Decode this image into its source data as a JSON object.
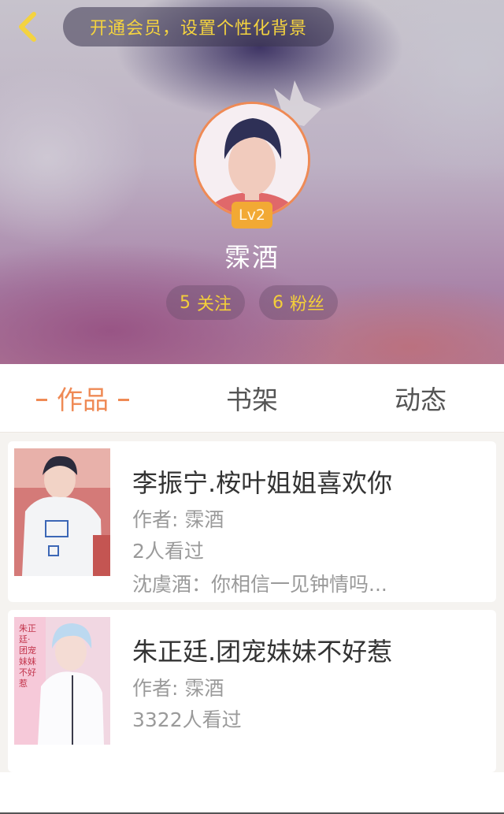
{
  "header": {
    "back_icon": "chevron-left-icon",
    "vip_banner": "开通会员，设置个性化背景",
    "level": "Lv2",
    "username": "霂酒",
    "following": {
      "count": "5",
      "label": "关注"
    },
    "followers": {
      "count": "6",
      "label": "粉丝"
    }
  },
  "tabs": [
    {
      "label": "作品",
      "active": true
    },
    {
      "label": "书架",
      "active": false
    },
    {
      "label": "动态",
      "active": false
    }
  ],
  "works": [
    {
      "title": "李振宁.桉叶姐姐喜欢你",
      "author": "作者: 霂酒",
      "views": "2人看过",
      "excerpt": "沈虞酒：你相信一见钟情吗..."
    },
    {
      "title": "朱正廷.团宠妹妹不好惹",
      "author": "作者: 霂酒",
      "views": "3322人看过",
      "cover_text": "朱正廷·团宠妹妹不好惹"
    }
  ],
  "colors": {
    "accent": "#ef8a55",
    "gold": "#f4cf3a",
    "badge": "#f2a934"
  }
}
